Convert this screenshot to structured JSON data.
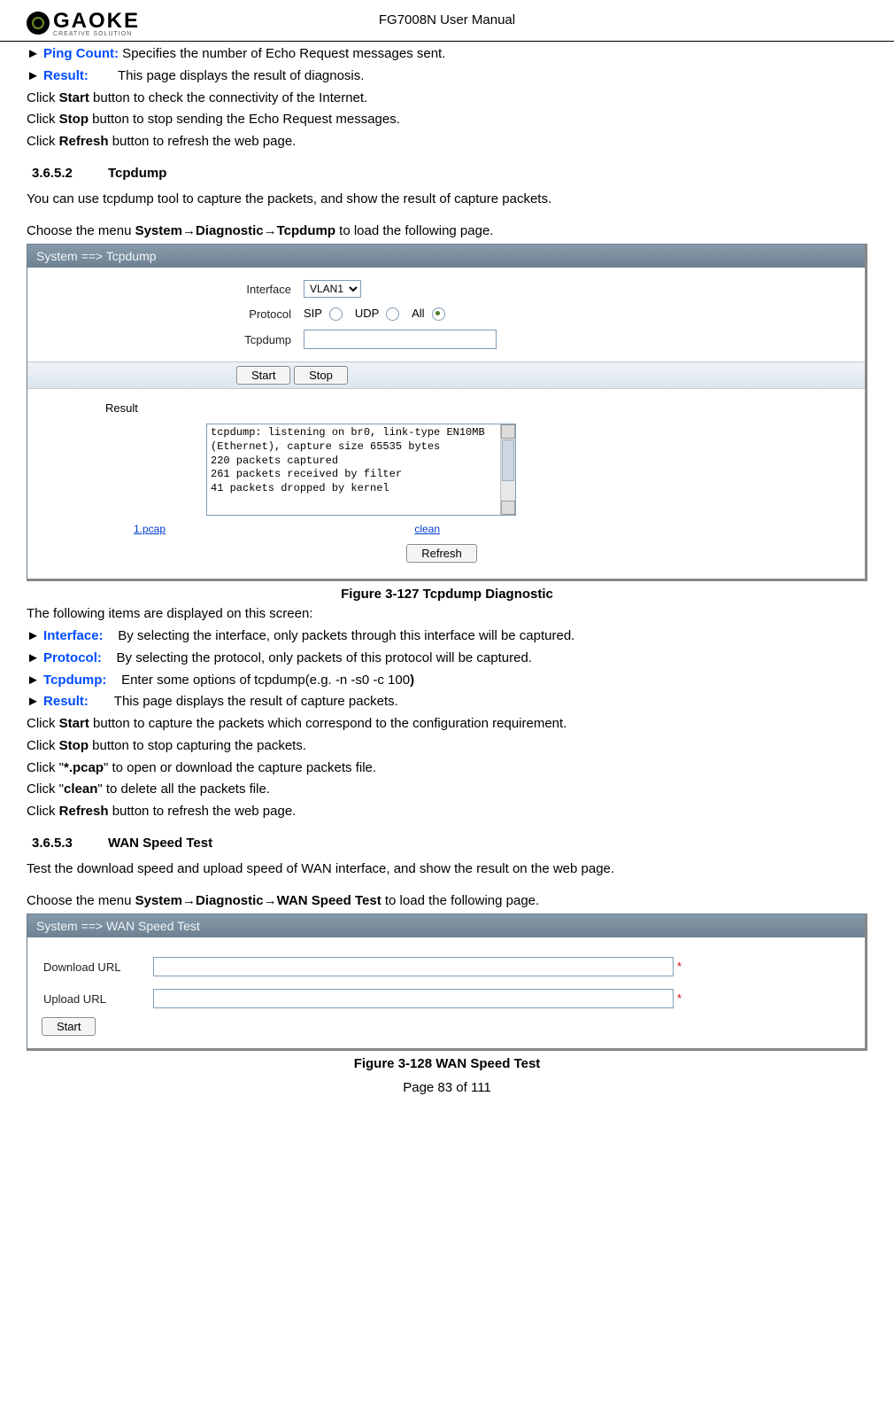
{
  "header": {
    "title": "FG7008N User Manual"
  },
  "logo": {
    "text": "GAOKE",
    "sub": "CREATIVE SOLUTION"
  },
  "intro": {
    "ping_count_label": "Ping Count:",
    "ping_count_text": " Specifies the number of Echo Request messages sent.",
    "result_label": "Result:",
    "result_text": "        This page displays the result of diagnosis.",
    "line_start": "Click ",
    "line_stop": "Click ",
    "line_refresh": "Click ",
    "start_bold": "Start",
    "start_rest": " button to check the connectivity of the Internet.",
    "stop_bold": "Stop",
    "stop_rest": " button to stop sending the Echo Request messages.",
    "refresh_bold": "Refresh",
    "refresh_rest": " button to refresh the web page."
  },
  "sec1": {
    "num": "3.6.5.2",
    "title": "Tcpdump"
  },
  "tcpdump_intro": {
    "line1": "You can use tcpdump tool to capture the packets, and show the result of capture packets.",
    "line2_a": "Choose the menu ",
    "line2_b": "System→Diagnostic→Tcpdump",
    "line2_c": " to load the following page."
  },
  "tcpdump_panel": {
    "title": "System ==> Tcpdump",
    "labels": {
      "interface": "Interface",
      "protocol": "Protocol",
      "tcpdump": "Tcpdump",
      "result": "Result"
    },
    "interface_sel": "VLAN1",
    "proto": {
      "sip": "SIP",
      "udp": "UDP",
      "all": "All",
      "selected": "all"
    },
    "tcpdump_value": "",
    "buttons": {
      "start": "Start",
      "stop": "Stop",
      "refresh": "Refresh"
    },
    "result_text": "tcpdump: listening on br0, link-type EN10MB\n(Ethernet), capture size 65535 bytes\n220 packets captured\n261 packets received by filter\n41 packets dropped by kernel",
    "links": {
      "pcap": "1.pcap",
      "clean": "clean"
    }
  },
  "fig1": "Figure 3-127  Tcpdump Diagnostic",
  "tcpdump_desc": {
    "line0": "The following items are displayed on this screen:",
    "interface_label": "Interface:",
    "interface_text": "    By selecting the interface, only packets through this interface will be captured.",
    "protocol_label": "Protocol:",
    "protocol_text": "    By selecting the protocol, only packets of this protocol will be captured.",
    "tcpdump_label": "Tcpdump:",
    "tcpdump_text_a": "    Enter some options of tcpdump(e.g. -n -s0 -c 100",
    "tcpdump_text_b": ")",
    "result_label": "Result:",
    "result_text": "       This page displays the result of capture packets.",
    "click_start_a": "Click ",
    "click_start_b": "Start",
    "click_start_c": " button to capture the packets which correspond to the configuration requirement.",
    "click_stop_a": "Click ",
    "click_stop_b": "Stop",
    "click_stop_c": " button to stop capturing the packets.",
    "click_pcap_a": "Click \"",
    "click_pcap_b": "*.pcap",
    "click_pcap_c": "\" to open or download the capture packets file.",
    "click_clean_a": "Click \"",
    "click_clean_b": "clean",
    "click_clean_c": "\" to delete all the packets file.",
    "click_refresh_a": "Click ",
    "click_refresh_b": "Refresh",
    "click_refresh_c": " button to refresh the web page."
  },
  "sec2": {
    "num": "3.6.5.3",
    "title": "WAN Speed Test"
  },
  "wan_intro": {
    "line1": "Test the download speed and upload speed of WAN interface, and show the result on the web page.",
    "line2_a": "Choose the menu ",
    "line2_b": "System→Diagnostic→WAN Speed Test",
    "line2_c": " to load the following page."
  },
  "wan_panel": {
    "title": "System ==> WAN Speed Test",
    "labels": {
      "download": "Download URL",
      "upload": "Upload URL"
    },
    "download_value": "",
    "upload_value": "",
    "button": "Start"
  },
  "fig2": "Figure 3-128  WAN Speed Test",
  "footer": "Page 83 of 111"
}
